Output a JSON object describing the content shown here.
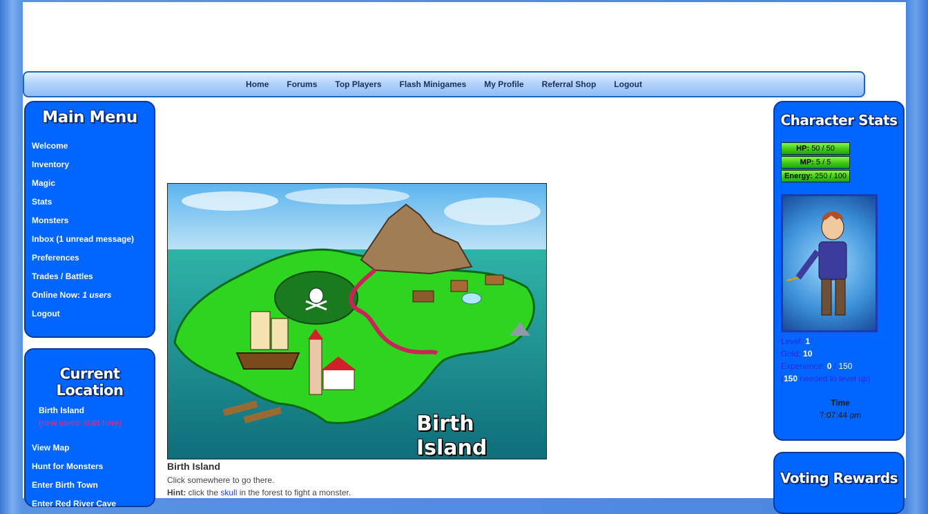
{
  "nav": [
    "Home",
    "Forums",
    "Top Players",
    "Flash Minigames",
    "My Profile",
    "Referral Shop",
    "Logout"
  ],
  "main_menu": {
    "title": "Main Menu",
    "items": [
      "Welcome",
      "Inventory",
      "Magic",
      "Stats",
      "Monsters",
      "Inbox (1 unread message)",
      "Preferences",
      "Trades / Battles"
    ],
    "online_label": "Online Now:",
    "online_value": "1 users",
    "logout": "Logout"
  },
  "location": {
    "title": "Current Location",
    "name": "Birth Island",
    "note": "(new users: start here)",
    "actions": [
      "View Map",
      "Hunt for Monsters",
      "Enter Birth Town",
      "Enter Red River Cave"
    ]
  },
  "map": {
    "label": "Birth Island",
    "title": "Birth Island",
    "instruction": "Click somewhere to go there.",
    "hint_label": "Hint:",
    "hint_pre": "click the",
    "hint_link": "skull",
    "hint_post": "in the forest to fight a monster."
  },
  "stats": {
    "title": "Character Stats",
    "hp_label": "HP:",
    "hp_value": "50 / 50",
    "mp_label": "MP:",
    "mp_value": "5 / 5",
    "energy_label": "Energy:",
    "energy_value": "250 / 100",
    "level_label": "Level:",
    "level_value": "1",
    "gold_label": "Gold:",
    "gold_value": "10",
    "exp_label": "Experience:",
    "exp_current": "0",
    "exp_sep": "/",
    "exp_max": "150",
    "needed_open": "(",
    "needed_value": "150",
    "needed_text": "needed to level up)",
    "time_label": "Time",
    "time_value": "7:07:44 pm"
  },
  "voting": {
    "title": "Voting Rewards"
  },
  "colors": {
    "panel": "#0066ff",
    "panel_border": "#0a3a9a",
    "bar": "#3fc916",
    "sea": "#1aa6a0",
    "land": "#33dd22"
  }
}
